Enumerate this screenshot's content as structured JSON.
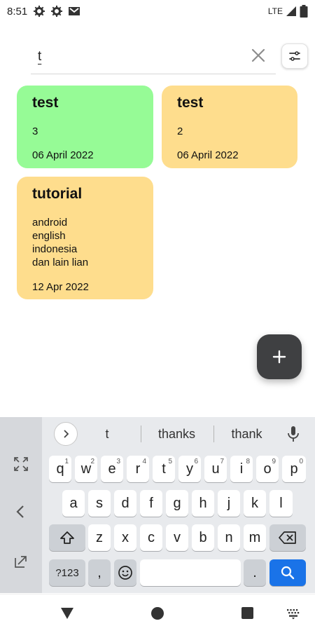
{
  "status_bar": {
    "time": "8:51",
    "network": "LTE",
    "icons": [
      "settings-icon",
      "settings-icon",
      "gmail-icon",
      "signal-icon",
      "battery-icon"
    ]
  },
  "search": {
    "value": "t",
    "clear_icon": "close-icon",
    "filter_icon": "filter-icon"
  },
  "notes": [
    {
      "title": "test",
      "body": "3",
      "date": "06 April 2022",
      "color": "#96fb96"
    },
    {
      "title": "test",
      "body": "2",
      "date": "06 April 2022",
      "color": "#fedd8d"
    },
    {
      "title": "tutorial",
      "body": "android\nenglish\nindonesia\ndan lain lian",
      "date": "12 Apr 2022",
      "color": "#fedd8d"
    }
  ],
  "fab": {
    "icon": "plus-icon"
  },
  "keyboard": {
    "suggestions": [
      "t",
      "thanks",
      "thank"
    ],
    "row1": [
      "q",
      "w",
      "e",
      "r",
      "t",
      "y",
      "u",
      "i",
      "o",
      "p"
    ],
    "row1_numbers": [
      "1",
      "2",
      "3",
      "4",
      "5",
      "6",
      "7",
      "8",
      "9",
      "0"
    ],
    "row2": [
      "a",
      "s",
      "d",
      "f",
      "g",
      "h",
      "j",
      "k",
      "l"
    ],
    "row3": [
      "z",
      "x",
      "c",
      "v",
      "b",
      "n",
      "m"
    ],
    "symbols_label": "?123",
    "comma_label": ",",
    "period_label": ".",
    "colors": {
      "accent": "#1a73e8",
      "keyboard_bg": "#e8eaed"
    }
  },
  "nav_bar": {
    "icons": [
      "back-icon",
      "home-icon",
      "recents-icon",
      "keyboard-switch-icon"
    ]
  }
}
